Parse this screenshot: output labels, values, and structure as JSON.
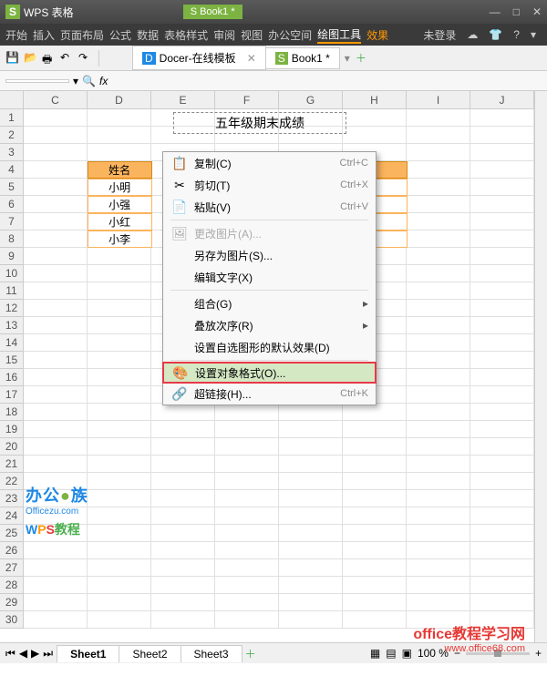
{
  "title_bar": {
    "logo": "S",
    "app_name": "WPS 表格",
    "doc_name": "Book1 *",
    "doc_icon": "S"
  },
  "menu": {
    "items": [
      "开始",
      "插入",
      "页面布局",
      "公式",
      "数据",
      "表格样式",
      "审阅",
      "视图",
      "办公空间",
      "绘图工具",
      "效果"
    ],
    "active_index": 9,
    "login": "未登录"
  },
  "toolbar_tabs": {
    "tab1": {
      "icon": "D",
      "label": "Docer-在线模板"
    },
    "tab2": {
      "icon": "S",
      "label": "Book1 *"
    }
  },
  "formula_bar": {
    "cell_ref": ""
  },
  "columns": [
    "C",
    "D",
    "E",
    "F",
    "G",
    "H",
    "I",
    "J"
  ],
  "rows": [
    "1",
    "2",
    "3",
    "4",
    "5",
    "6",
    "7",
    "8",
    "9",
    "10",
    "11",
    "12",
    "13",
    "14",
    "15",
    "16",
    "17",
    "18",
    "19",
    "20",
    "21",
    "22",
    "23",
    "24",
    "25",
    "26",
    "27",
    "28",
    "29",
    "30"
  ],
  "textbox_text": "五年级期末成绩",
  "table_data": {
    "header": "姓名",
    "names": [
      "小明",
      "小强",
      "小红",
      "小李"
    ]
  },
  "context_menu": {
    "copy": {
      "label": "复制(C)",
      "shortcut": "Ctrl+C"
    },
    "cut": {
      "label": "剪切(T)",
      "shortcut": "Ctrl+X"
    },
    "paste": {
      "label": "粘贴(V)",
      "shortcut": "Ctrl+V"
    },
    "change_image": {
      "label": "更改图片(A)..."
    },
    "save_as_image": {
      "label": "另存为图片(S)..."
    },
    "edit_text": {
      "label": "编辑文字(X)"
    },
    "group": {
      "label": "组合(G)"
    },
    "order": {
      "label": "叠放次序(R)"
    },
    "default_shape": {
      "label": "设置自选图形的默认效果(D)"
    },
    "format_object": {
      "label": "设置对象格式(O)..."
    },
    "hyperlink": {
      "label": "超链接(H)...",
      "shortcut": "Ctrl+K"
    }
  },
  "watermark": {
    "line1_a": "办公",
    "line1_b": "族",
    "line2": "Officezu.com",
    "line3_wps": "WPS",
    "line3_rest": "教程"
  },
  "status": {
    "sheets": [
      "Sheet1",
      "Sheet2",
      "Sheet3"
    ],
    "zoom": "100 %"
  },
  "footer": {
    "line1": "office教程学习网",
    "line2": "www.office68.com"
  }
}
